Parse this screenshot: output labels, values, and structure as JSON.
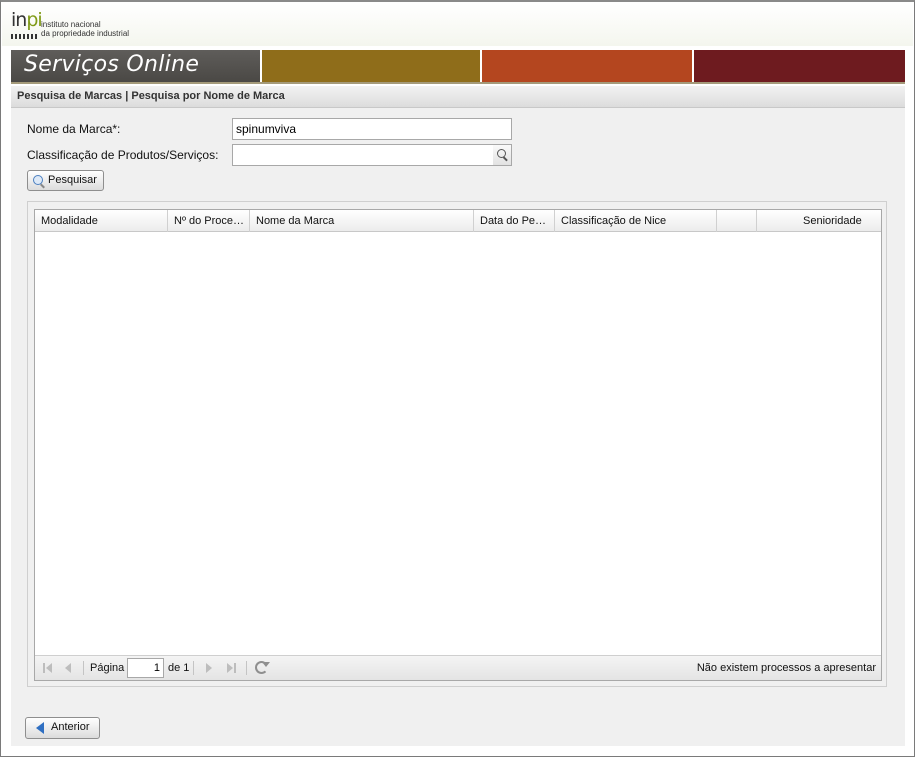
{
  "logo": {
    "mark_in": "in",
    "mark_pi": "pi",
    "line1": "instituto nacional",
    "line2": "da propriedade industrial"
  },
  "banner": {
    "title_bold": "Serviços On",
    "title_light": "line",
    "colors": [
      "#55534f",
      "#8f6d1a",
      "#b4461f",
      "#6e1b1f"
    ]
  },
  "breadcrumb": {
    "text": "Pesquisa de Marcas | Pesquisa por Nome de Marca"
  },
  "form": {
    "brand_name_label": "Nome da Marca*:",
    "brand_name_value": "spinumviva",
    "classification_label": "Classificação de Produtos/Serviços:",
    "classification_value": "",
    "search_button": "Pesquisar"
  },
  "grid": {
    "columns": [
      "Modalidade",
      "Nº do Proce…",
      "Nome da Marca",
      "Data do Pe…",
      "Classificação de Nice",
      "",
      "Senioridade"
    ],
    "rows": [],
    "pager": {
      "page_label": "Página",
      "page_value": "1",
      "of_label": "de 1",
      "status": "Não existem processos a apresentar"
    }
  },
  "footer": {
    "back_button": "Anterior"
  }
}
